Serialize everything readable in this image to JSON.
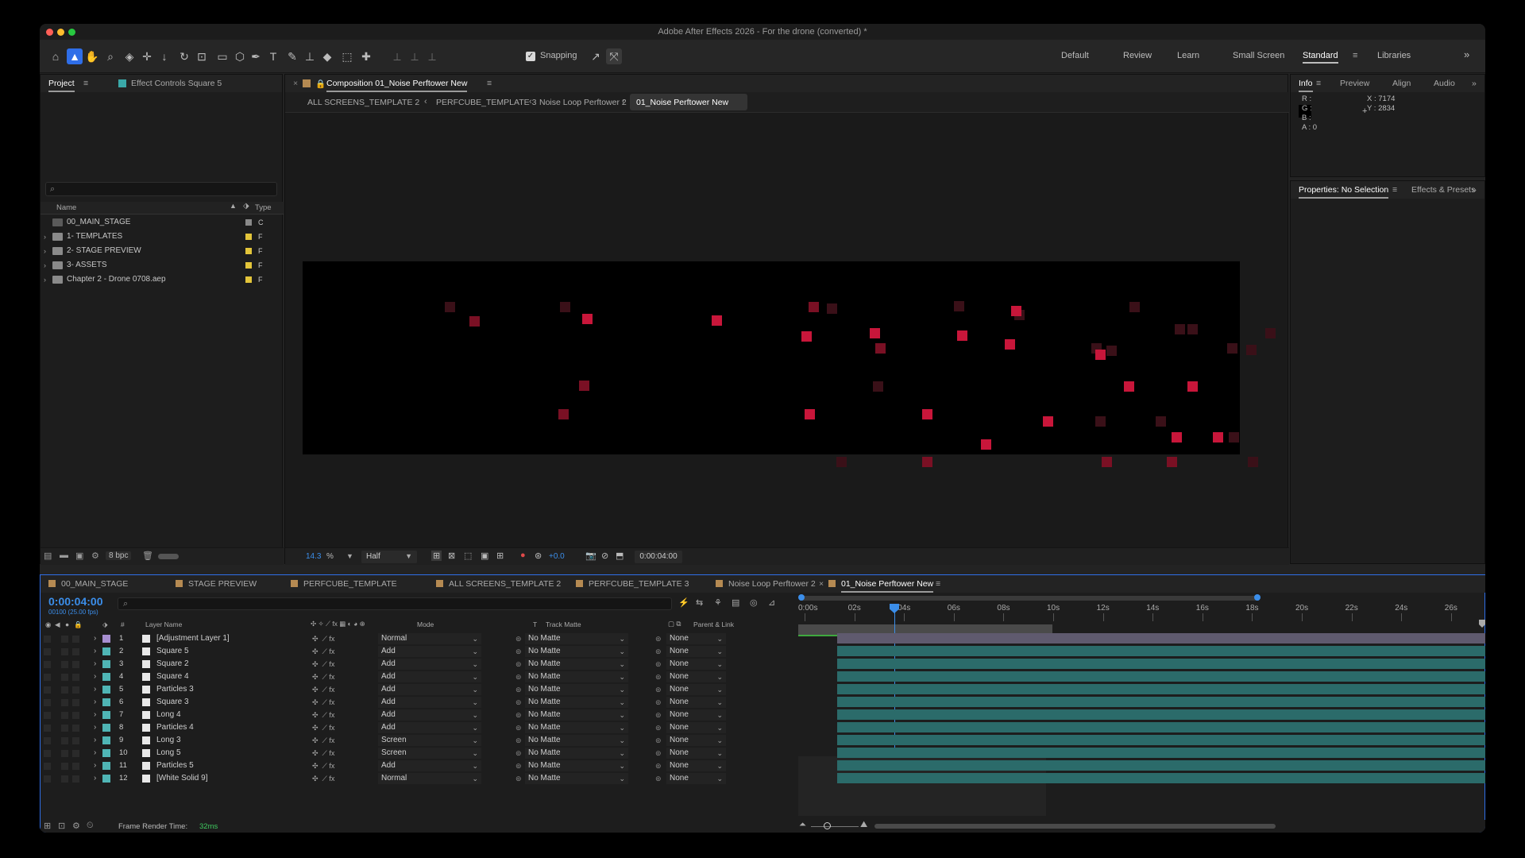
{
  "window": {
    "title": "Adobe After Effects 2026 - For the drone (converted) *"
  },
  "toolbar": {
    "snapping_label": "Snapping",
    "workspaces": [
      "Default",
      "Review",
      "Learn",
      "Small Screen",
      "Standard",
      "Libraries"
    ]
  },
  "project_panel": {
    "tab_project": "Project",
    "tab_effect_controls": "Effect Controls Square 5",
    "search_placeholder": "",
    "col_name": "Name",
    "col_type": "Type",
    "items": [
      {
        "name": "00_MAIN_STAGE",
        "type": "C"
      },
      {
        "name": "1- TEMPLATES",
        "type": "F"
      },
      {
        "name": "2- STAGE PREVIEW",
        "type": "F"
      },
      {
        "name": "3- ASSETS",
        "type": "F"
      },
      {
        "name": "Chapter 2 - Drone 0708.aep",
        "type": "F"
      }
    ],
    "bpc": "8 bpc"
  },
  "composition_panel": {
    "tab_label": "Composition 01_Noise Perftower New",
    "breadcrumbs": [
      "ALL SCREENS_TEMPLATE 2",
      "PERFCUBE_TEMPLATE 3",
      "Noise Loop Perftower 2",
      "01_Noise Perftower New"
    ],
    "zoom": "14.3",
    "zoom_unit": "%",
    "resolution": "Half",
    "exposure": "+0.0",
    "timecode": "0:00:04:00"
  },
  "info_panel": {
    "tabs": [
      "Info",
      "Preview",
      "Align",
      "Audio"
    ],
    "r": "R :",
    "g": "G :",
    "b": "B :",
    "a": "A :  0",
    "x": "X : 7174",
    "y": "Y : 2834"
  },
  "properties_panel": {
    "tab_properties": "Properties: No Selection",
    "tab_effects": "Effects & Presets"
  },
  "timeline": {
    "tabs": [
      "00_MAIN_STAGE",
      "STAGE PREVIEW",
      "PERFCUBE_TEMPLATE",
      "ALL SCREENS_TEMPLATE 2",
      "PERFCUBE_TEMPLATE 3",
      "Noise Loop Perftower 2",
      "01_Noise Perftower New"
    ],
    "timecode": "0:00:04:00",
    "fps": "00100 (25.00 fps)",
    "col_num": "#",
    "col_layer": "Layer Name",
    "col_mode": "Mode",
    "col_t": "T",
    "col_trackmatte": "Track Matte",
    "col_parent": "Parent & Link",
    "ruler": [
      "0:00s",
      "02s",
      "04s",
      "06s",
      "08s",
      "10s",
      "12s",
      "14s",
      "16s",
      "18s",
      "20s",
      "22s",
      "24s",
      "26s"
    ],
    "layers": [
      {
        "num": "1",
        "name": "[Adjustment Layer 1]",
        "mode": "Normal",
        "matte": "No Matte",
        "parent": "None",
        "color": "#a78fd0"
      },
      {
        "num": "2",
        "name": "Square 5",
        "mode": "Add",
        "matte": "No Matte",
        "parent": "None",
        "color": "#4fb5b5"
      },
      {
        "num": "3",
        "name": "Square 2",
        "mode": "Add",
        "matte": "No Matte",
        "parent": "None",
        "color": "#4fb5b5"
      },
      {
        "num": "4",
        "name": "Square 4",
        "mode": "Add",
        "matte": "No Matte",
        "parent": "None",
        "color": "#4fb5b5"
      },
      {
        "num": "5",
        "name": "Particles 3",
        "mode": "Add",
        "matte": "No Matte",
        "parent": "None",
        "color": "#4fb5b5"
      },
      {
        "num": "6",
        "name": "Square 3",
        "mode": "Add",
        "matte": "No Matte",
        "parent": "None",
        "color": "#4fb5b5"
      },
      {
        "num": "7",
        "name": "Long 4",
        "mode": "Add",
        "matte": "No Matte",
        "parent": "None",
        "color": "#4fb5b5"
      },
      {
        "num": "8",
        "name": "Particles 4",
        "mode": "Add",
        "matte": "No Matte",
        "parent": "None",
        "color": "#4fb5b5"
      },
      {
        "num": "9",
        "name": "Long 3",
        "mode": "Screen",
        "matte": "No Matte",
        "parent": "None",
        "color": "#4fb5b5"
      },
      {
        "num": "10",
        "name": "Long 5",
        "mode": "Screen",
        "matte": "No Matte",
        "parent": "None",
        "color": "#4fb5b5"
      },
      {
        "num": "11",
        "name": "Particles 5",
        "mode": "Add",
        "matte": "No Matte",
        "parent": "None",
        "color": "#4fb5b5"
      },
      {
        "num": "12",
        "name": "[White Solid 9]",
        "mode": "Normal",
        "matte": "No Matte",
        "parent": "None",
        "color": "#4fb5b5"
      }
    ],
    "render_time_label": "Frame Render Time:",
    "render_time_value": "32ms"
  },
  "colors": {
    "accent_blue": "#2f6ee8",
    "timecode_blue": "#3b8eea",
    "square_red": "#c8163a",
    "clip_teal": "#2b6b6a"
  }
}
